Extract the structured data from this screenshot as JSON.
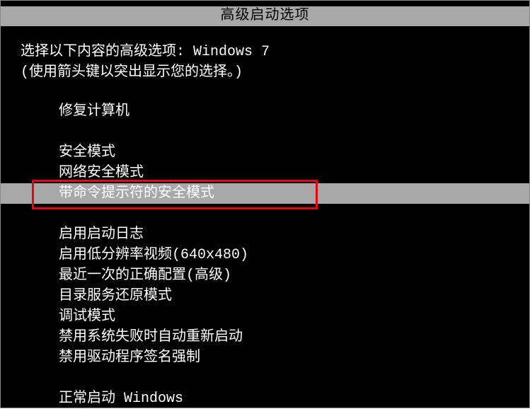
{
  "title": "高级启动选项",
  "prompt_line1": "选择以下内容的高级选项: Windows 7",
  "prompt_line2": "(使用箭头键以突出显示您的选择。)",
  "menu": {
    "repair": "修复计算机",
    "safe_mode": "安全模式",
    "safe_mode_net": "网络安全模式",
    "safe_mode_cmd": "带命令提示符的安全模式",
    "boot_log": "启用启动日志",
    "low_res": "启用低分辨率视频(640x480)",
    "last_known": "最近一次的正确配置(高级)",
    "ds_restore": "目录服务还原模式",
    "debug": "调试模式",
    "no_auto_restart": "禁用系统失败时自动重新启动",
    "no_driver_sig": "禁用驱动程序签名强制",
    "normal": "正常启动 Windows"
  }
}
